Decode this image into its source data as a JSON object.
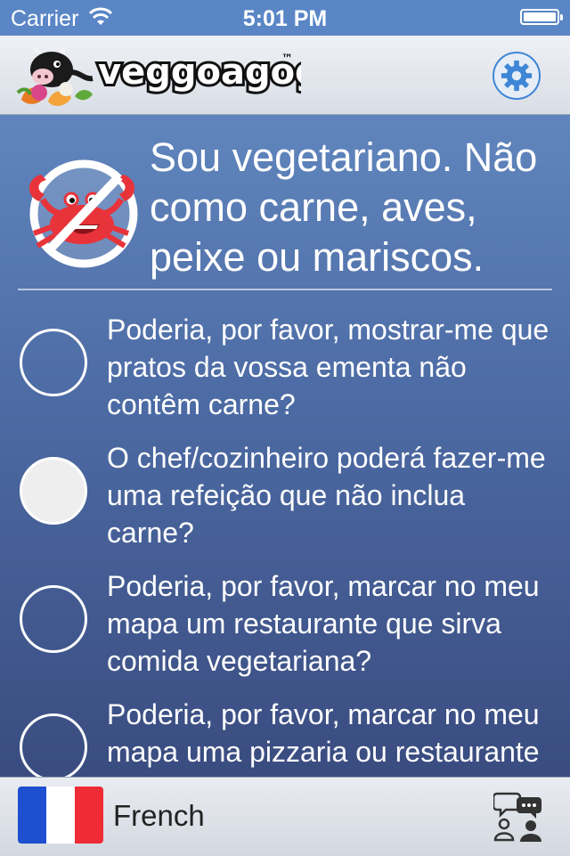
{
  "status_bar": {
    "carrier": "Carrier",
    "time": "5:01 PM",
    "battery_level": 1.0
  },
  "nav_bar": {
    "logo_text": "veggoagogo",
    "logo_trademark": "™",
    "settings_icon": "gear-icon",
    "accent_color": "#3f86d6"
  },
  "main": {
    "header_icon": "no-seafood-crab-icon",
    "header_text": "Sou vegetariano. Não como carne, aves, peixe ou mariscos.",
    "questions": [
      {
        "text": "Poderia, por favor, mostrar-me que pratos da vossa ementa não contêm carne?"
      },
      {
        "text": "O chef/cozinheiro poderá fazer-me uma refeição que não inclua carne?"
      },
      {
        "text": "Poderia, por favor, marcar no meu mapa um restaurante que sirva comida vegetariana?"
      },
      {
        "text": "Poderia, por favor, marcar no meu mapa uma pizzaria ou restaurante italiano?"
      }
    ],
    "selected_index": 1
  },
  "footer": {
    "language": "French",
    "flag_colors": [
      "#1f4fd1",
      "#ffffff",
      "#ef2b35"
    ],
    "conversation_icon": "conversation-people-icon"
  }
}
